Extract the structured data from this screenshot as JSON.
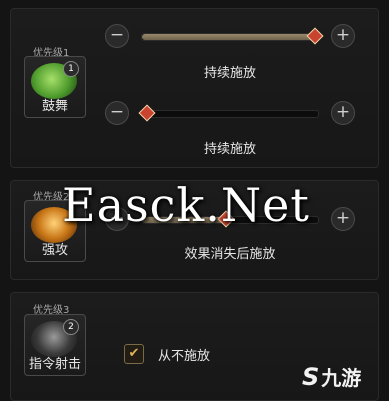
{
  "rows": [
    {
      "priority": "优先级1",
      "skill_name": "鼓舞",
      "badge": "1",
      "icon": "green-sparkle-icon",
      "icon_color": "#4d9b2c",
      "slider_a": {
        "value": 0.98,
        "caption": "持续施放"
      },
      "slider_b": {
        "value": 0.02,
        "caption": "持续施放"
      }
    },
    {
      "priority": "优先级2",
      "skill_name": "强攻",
      "icon": "strike-icon",
      "icon_color": "#c97717",
      "slider_a": {
        "value": 0.47,
        "caption": "效果消失后施放"
      }
    },
    {
      "priority": "优先级3",
      "skill_name": "指令射击",
      "badge": "2",
      "icon": "arrows-icon",
      "icon_color": "#3a3a3a",
      "option": {
        "checked": true,
        "label": "从不施放"
      }
    }
  ],
  "controls": {
    "minus": "−",
    "plus": "+",
    "check": "✔"
  },
  "watermark": "Easck.Net",
  "logo": {
    "mark": "S",
    "text": "九游"
  }
}
